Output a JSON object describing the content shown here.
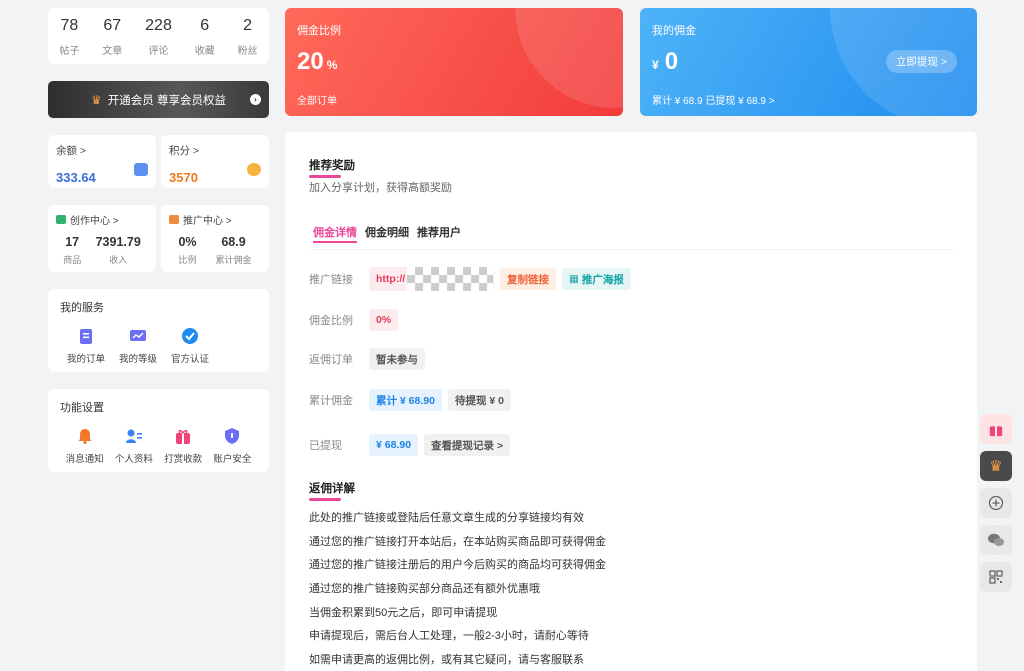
{
  "stats": [
    {
      "value": "78",
      "label": "帖子"
    },
    {
      "value": "67",
      "label": "文章"
    },
    {
      "value": "228",
      "label": "评论"
    },
    {
      "value": "6",
      "label": "收藏"
    },
    {
      "value": "2",
      "label": "粉丝"
    }
  ],
  "vip": {
    "label": "开通会员 尊享会员权益"
  },
  "balance": {
    "title": "余额 >",
    "value": "333.64"
  },
  "points": {
    "title": "积分 >",
    "value": "3570"
  },
  "creator": {
    "title": "创作中心 >",
    "items": [
      {
        "value": "17",
        "label": "商品"
      },
      {
        "value": "7391.79",
        "label": "收入"
      }
    ]
  },
  "promo": {
    "title": "推广中心 >",
    "items": [
      {
        "value": "0%",
        "label": "比例"
      },
      {
        "value": "68.9",
        "label": "累计佣金"
      }
    ]
  },
  "services": {
    "title": "我的服务",
    "items": [
      "我的订单",
      "我的等级",
      "官方认证"
    ]
  },
  "settings": {
    "title": "功能设置",
    "items": [
      "消息通知",
      "个人资料",
      "打赏收款",
      "账户安全"
    ]
  },
  "rate_banner": {
    "title": "佣金比例",
    "value": "20",
    "unit": "%",
    "footer": "全部订单"
  },
  "earn_banner": {
    "title": "我的佣金",
    "currency": "¥",
    "value": "0",
    "footer": "累计 ¥ 68.9   已提现 ¥ 68.9 >",
    "button": "立即提现 >"
  },
  "main": {
    "section1_title": "推荐奖励",
    "section1_sub": "加入分享计划，获得高额奖励",
    "tabs": [
      "佣金详情",
      "佣金明细",
      "推荐用户"
    ],
    "rows": {
      "link_label": "推广链接",
      "link_prefix": "http://",
      "copy_btn": "复制链接",
      "poster_btn": "推广海报",
      "rate_label": "佣金比例",
      "rate_value": "0%",
      "order_label": "返佣订单",
      "order_value": "暂未参与",
      "total_label": "累计佣金",
      "total_value": "累计 ¥ 68.90",
      "pending_value": "待提现 ¥ 0",
      "withdrawn_label": "已提现",
      "withdrawn_value": "¥ 68.90",
      "records_btn": "查看提现记录 >"
    },
    "section2_title": "返佣详解",
    "details": [
      "此处的推广链接或登陆后任意文章生成的分享链接均有效",
      "通过您的推广链接打开本站后，在本站购买商品即可获得佣金",
      "通过您的推广链接注册后的用户今后购买的商品均可获得佣金",
      "通过您的推广链接购买部分商品还有额外优惠哦",
      "当佣金积累到50元之后，即可申请提现",
      "申请提现后，需后台人工处理，一般2-3小时，请耐心等待",
      "如需申请更高的返佣比例，或有其它疑问，请与客服联系"
    ]
  },
  "colors": {
    "accent": "#ec4899",
    "red": "#f23b3b",
    "blue": "#1e8bf0"
  }
}
